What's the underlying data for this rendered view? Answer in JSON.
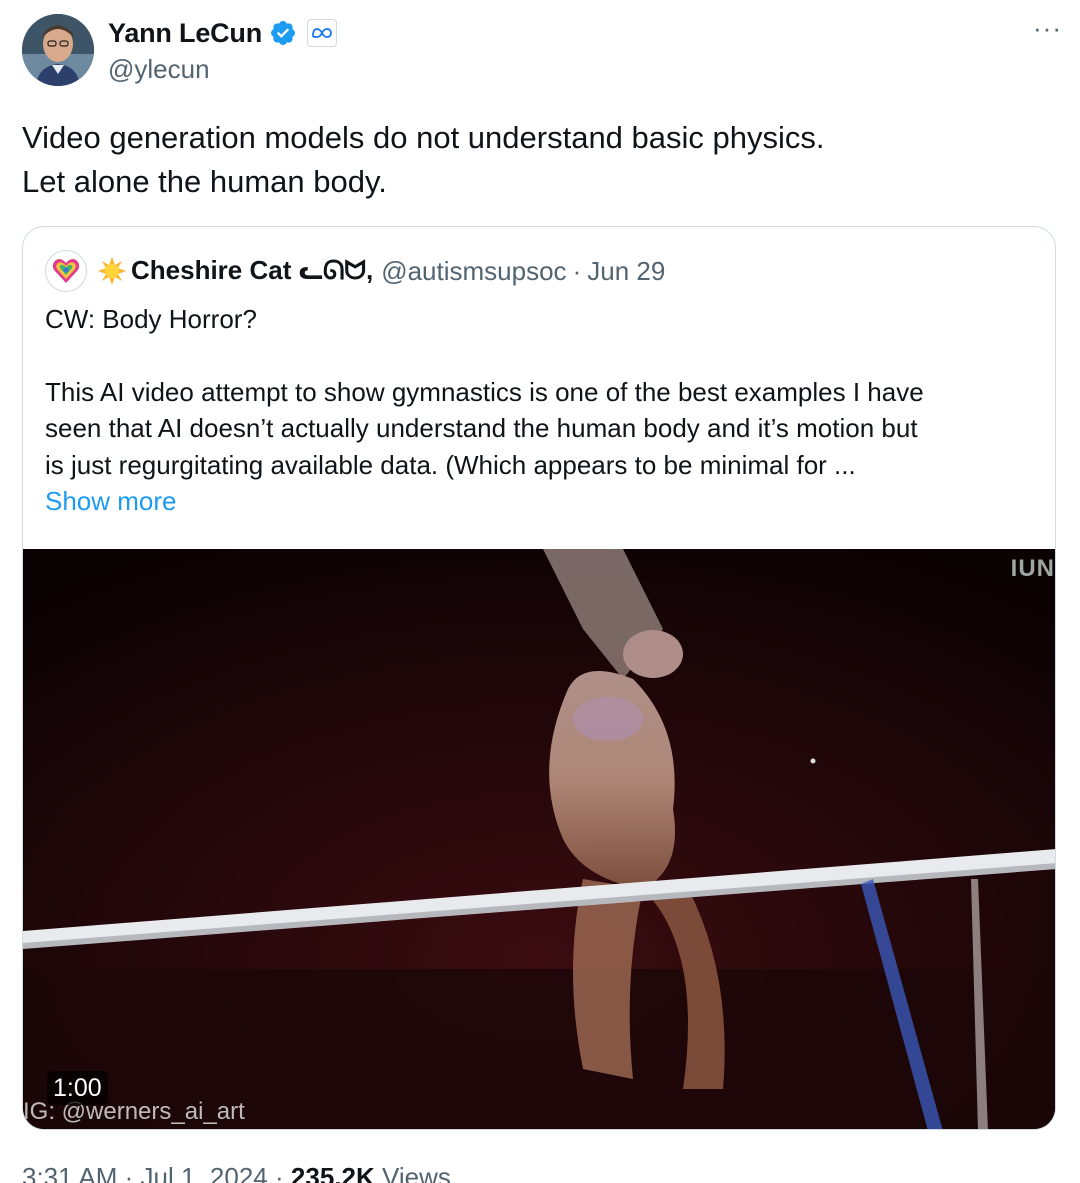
{
  "author": {
    "display_name": "Yann LeCun",
    "handle": "@ylecun",
    "verified_icon": "verified-badge-icon",
    "affiliation_icon": "meta-logo-icon"
  },
  "more_label": "···",
  "tweet": {
    "line1": "Video generation models do not understand basic physics.",
    "line2": "Let alone the human body."
  },
  "quoted": {
    "display_name": "Cheshire Cat ᓚᘏᗢ,",
    "handle": "@autismsupsoc",
    "separator": "·",
    "date": "Jun 29",
    "line1": "CW: Body Horror?",
    "body_l1": "This AI video attempt to show gymnastics is one of the best examples I have",
    "body_l2": "seen that AI doesn’t actually understand the human body and it’s motion but",
    "body_l3": "is just regurgitating available data. (Which appears to be minimal for ...",
    "show_more": "Show more",
    "video": {
      "duration": "1:00",
      "watermark": "IG: @werners_ai_art",
      "broadcast_logo": "IUN"
    }
  },
  "meta": {
    "time": "3:31 AM",
    "dot": "·",
    "date": "Jul 1, 2024",
    "views_count": "235.2K",
    "views_label": "Views"
  },
  "colors": {
    "text": "#0f1419",
    "secondary": "#536471",
    "link": "#1d9bf0",
    "border": "#cfd9de"
  }
}
